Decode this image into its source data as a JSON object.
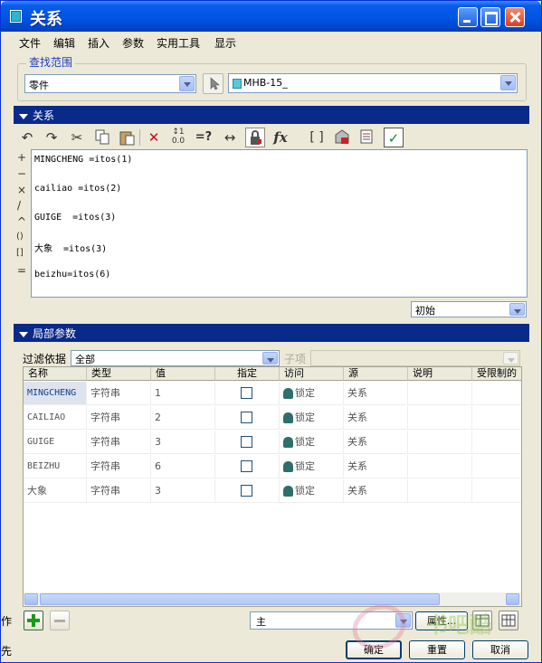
{
  "window": {
    "title": "关系"
  },
  "menu": [
    "文件",
    "编辑",
    "插入",
    "参数",
    "实用工具",
    "显示"
  ],
  "find_scope": {
    "label": "查找范围",
    "type_value": "零件",
    "model_value": "MHB-15_"
  },
  "relations_section": {
    "title": "关系",
    "operators": [
      "+",
      "−",
      "×",
      "/",
      "^",
      "()",
      "[]",
      "="
    ],
    "lines": [
      "MINGCHENG =itos(1)",
      "cailiao =itos(2)",
      "GUIGE  =itos(3)",
      "大象  =itos(3)",
      "beizhu=itos(6)"
    ],
    "state_value": "初始"
  },
  "local_params": {
    "title": "局部参数",
    "filter_label": "过滤依据",
    "filter_value": "全部",
    "subitem_label": "子项",
    "columns": [
      "名称",
      "类型",
      "值",
      "指定",
      "访问",
      "源",
      "说明",
      "受限制的"
    ],
    "rows": [
      {
        "name": "MINGCHENG",
        "type": "字符串",
        "value": "1",
        "access": "锁定",
        "source": "关系"
      },
      {
        "name": "CAILIAO",
        "type": "字符串",
        "value": "2",
        "access": "锁定",
        "source": "关系"
      },
      {
        "name": "GUIGE",
        "type": "字符串",
        "value": "3",
        "access": "锁定",
        "source": "关系"
      },
      {
        "name": "BEIZHU",
        "type": "字符串",
        "value": "6",
        "access": "锁定",
        "source": "关系"
      },
      {
        "name": "大象",
        "type": "字符串",
        "value": "3",
        "access": "锁定",
        "source": "关系"
      }
    ],
    "main_value": "主",
    "props_label": "属性..."
  },
  "footer": {
    "ok": "确定",
    "reset": "重置",
    "cancel": "取消"
  },
  "side_fragments": [
    "作",
    "先"
  ],
  "watermark": "书吧酷"
}
